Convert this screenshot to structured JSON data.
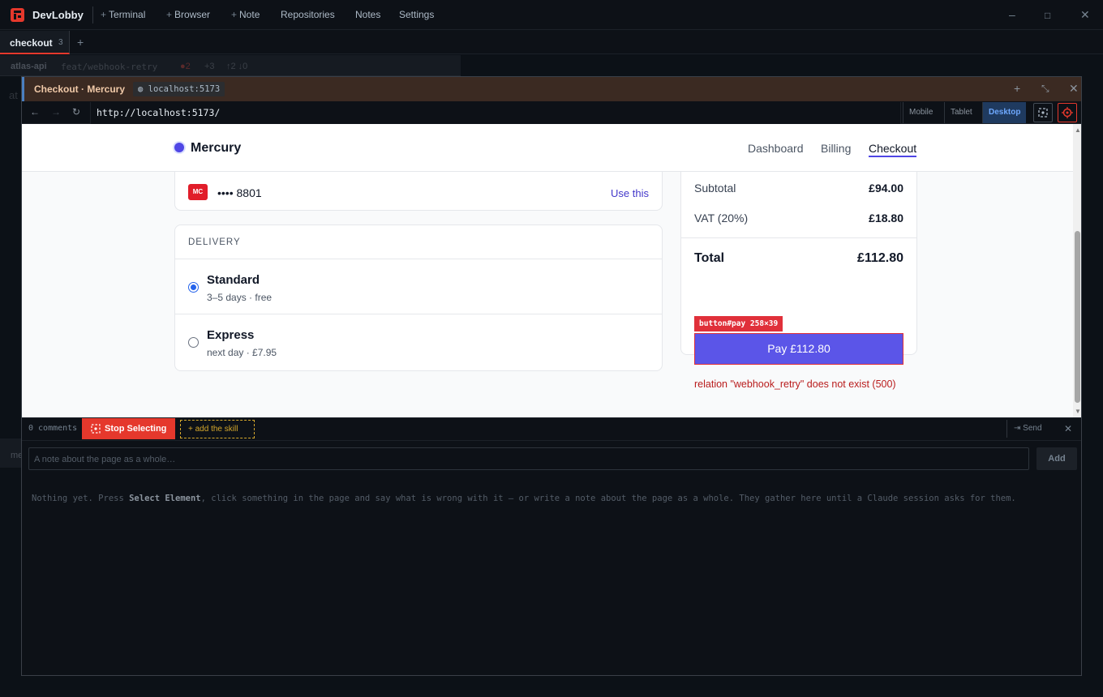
{
  "app": {
    "name": "DevLobby",
    "menu": [
      {
        "plus": "+",
        "label": "Terminal"
      },
      {
        "plus": "+",
        "label": "Browser"
      },
      {
        "plus": "+",
        "label": "Note"
      },
      {
        "plus": "",
        "label": "Repositories"
      },
      {
        "plus": "",
        "label": "Notes"
      },
      {
        "plus": "",
        "label": "Settings"
      }
    ],
    "window_controls": [
      "–",
      "□",
      "✕"
    ]
  },
  "tabs": [
    {
      "label": "checkout",
      "count": "3"
    }
  ],
  "tab_add": "+",
  "background_pane": {
    "repo": "atlas-api",
    "branch": "feat/webhook-retry",
    "errors": "●2",
    "changes": "+3",
    "sync": "↑2 ↓0",
    "side_label": "at",
    "side_label2": "me"
  },
  "browser": {
    "title": "Checkout · Mercury",
    "host_chip": "localhost:5173",
    "url": "http://localhost:5173/",
    "devices": [
      "Mobile",
      "Tablet",
      "Desktop"
    ],
    "active_device": "Desktop"
  },
  "page": {
    "brand": "Mercury",
    "nav": [
      "Dashboard",
      "Billing",
      "Checkout"
    ],
    "active_nav": "Checkout",
    "saved_card": {
      "badge": "MC",
      "number": "•••• 8801",
      "action": "Use this"
    },
    "delivery": {
      "heading": "DELIVERY",
      "options": [
        {
          "name": "Standard",
          "detail": "3–5 days · free",
          "selected": true
        },
        {
          "name": "Express",
          "detail": "next day · £7.95",
          "selected": false
        }
      ]
    },
    "summary": {
      "subtotal_label": "Subtotal",
      "subtotal": "£94.00",
      "vat_label": "VAT (20%)",
      "vat": "£18.80",
      "total_label": "Total",
      "total": "£112.80"
    },
    "pay_button": "Pay £112.80",
    "inspector_tag": "button#pay  258×39",
    "error": "relation \"webhook_retry\" does not exist (500)"
  },
  "feedback": {
    "comments": "0 comments",
    "stop_button": "Stop Selecting",
    "skill_button": "+ add the skill",
    "send": "⇥ Send",
    "note_placeholder": "A note about the page as a whole…",
    "add": "Add",
    "empty_1": "Nothing yet. Press ",
    "empty_bold": "Select Element",
    "empty_2": ", click something in the page and say what is wrong with it — or write a note about the page as a whole. They gather here until a Claude session asks for them."
  },
  "colors": {
    "accent": "#e5382c",
    "brand": "#4f46e5",
    "pay": "#5b55e8",
    "error": "#b91c1c"
  }
}
